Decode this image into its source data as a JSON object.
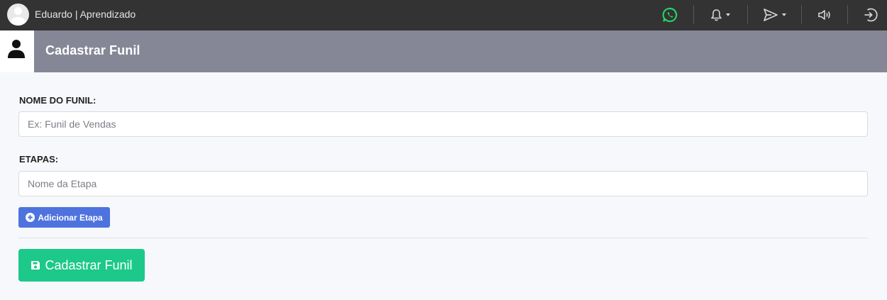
{
  "topbar": {
    "username": "Eduardo | Aprendizado",
    "icons": {
      "whatsapp": "whatsapp-icon",
      "notifications": "bell-icon",
      "messages": "send-icon",
      "sound": "speaker-icon",
      "logout": "sign-in-icon"
    },
    "colors": {
      "background": "#333333",
      "whatsapp": "#25d366"
    }
  },
  "header": {
    "title": "Cadastrar Funil",
    "icon": "user-icon",
    "color": "#868796"
  },
  "form": {
    "name_label": "NOME DO FUNIL:",
    "name_placeholder": "Ex: Funil de Vendas",
    "stages_label": "ETAPAS:",
    "stage_placeholder": "Nome da Etapa",
    "add_stage_label": "Adicionar Etapa",
    "add_stage_icon": "plus-circle-icon",
    "submit_label": "Cadastrar Funil",
    "submit_icon": "save-icon"
  },
  "colors": {
    "primary": "#4e73df",
    "success": "#1cc88a"
  }
}
